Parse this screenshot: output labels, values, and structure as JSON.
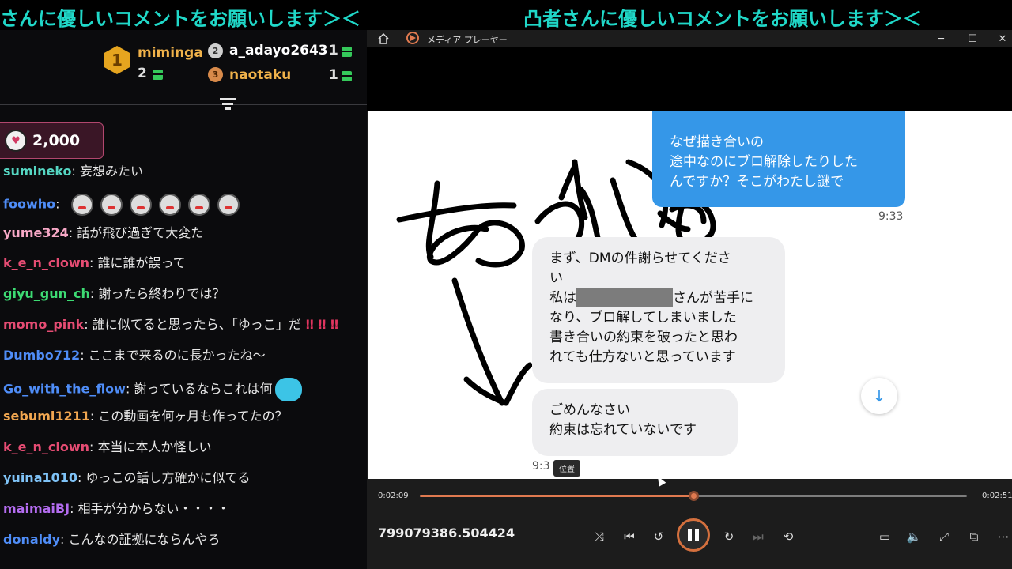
{
  "ticker": {
    "text_left": "さんに優しいコメントをお願いします＞＜",
    "text_right": "凸者さんに優しいコメントをお願いします＞＜"
  },
  "leaderboard": [
    {
      "rank": "1",
      "name": "miminga",
      "count": "2"
    },
    {
      "rank": "2",
      "name": "a_adayo2643",
      "count": "1"
    },
    {
      "rank": "3",
      "name": "naotaku",
      "count": "1"
    }
  ],
  "pinned": {
    "amount": "2,000"
  },
  "chat": [
    {
      "user": "sumineko",
      "text": "妄想みたい",
      "color": "#55d6c2"
    },
    {
      "user": "foowho",
      "text": "",
      "color": "#4f8df7",
      "emotes": 6
    },
    {
      "user": "yume324",
      "text": "話が飛び過ぎて大変た",
      "color": "#f7a8c6"
    },
    {
      "user": "k_e_n_clown",
      "text": "誰に誰が誤って",
      "color": "#e64c73"
    },
    {
      "user": "giyu_gun_ch",
      "text": "謝ったら終わりでは？",
      "color": "#3ddb73"
    },
    {
      "user": "momo_pink",
      "text": "誰に似てると思ったら、「ゆっこ」だ",
      "color": "#e64c73",
      "bangs": "‼ ‼ ‼"
    },
    {
      "user": "Dumbo712",
      "text": "ここまで来るのに長かったね〜",
      "color": "#4f8df7"
    },
    {
      "user": "Go_with_the_flow",
      "text": "謝っているならこれは何",
      "color": "#4f8df7",
      "cat": true
    },
    {
      "user": "sebumi1211",
      "text": "この動画を何ヶ月も作ってたの？",
      "color": "#f0a650"
    },
    {
      "user": "k_e_n_clown",
      "text": "本当に本人か怪しい",
      "color": "#e64c73"
    },
    {
      "user": "yuina1010",
      "text": "ゆっこの話し方確かに似てる",
      "color": "#7fc3f7"
    },
    {
      "user": "maimaiBJ",
      "text": "相手が分からない・・・・",
      "color": "#b46cf0"
    },
    {
      "user": "donaldy",
      "text": "こんなの証拠にならんやろ",
      "color": "#4f8df7"
    }
  ],
  "player": {
    "title": "メディア プレーヤー",
    "filename": "799079386.504424",
    "time_current": "0:02:09",
    "time_total": "0:02:51",
    "progress": 0.5,
    "tooltip": "位置",
    "accent": "#e07a50"
  },
  "video": {
    "handwriting": "あかりさん",
    "bubble_right": [
      "なぜ描き合いの",
      "途中なのにブロ解除したりした",
      "んですか？そこがわたし謎で"
    ],
    "time_right": "9:33",
    "bubble_left1_a": "まず、DMの件謝らせてくださ",
    "bubble_left1_b": "い",
    "bubble_left1_c_pre": "私は",
    "bubble_left1_c_post": "さんが苦手に",
    "bubble_left1_d": "なり、ブロ解してしまいました",
    "bubble_left1_e": "書き合いの約束を破ったと思わ",
    "bubble_left1_f": "れても仕方ないと思っています",
    "bubble_left2": [
      "ごめんなさい",
      "約束は忘れていないです"
    ],
    "time_left": "9:3"
  }
}
